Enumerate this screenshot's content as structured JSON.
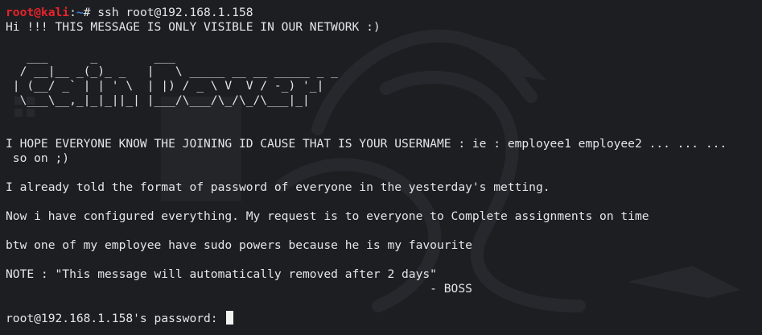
{
  "prompt": {
    "user_host": "root@kali",
    "separator": ":",
    "path": "~",
    "symbol": "# ",
    "command": "ssh root@192.168.1.158"
  },
  "lines": {
    "welcome": "Hi !!! THIS MESSAGE IS ONLY VISIBLE IN OUR NETWORK :)",
    "ascii_1": "   ___      _        ___",
    "ascii_2": "  / __|__ _(_)_ _   |   \\ _____ __ __ _____ _ _",
    "ascii_3": " | (__/ _` | | ' \\  | |) / _ \\ V  V / -_) '_|",
    "ascii_4": "  \\___\\__,_|_|_||_| |___/\\___/\\_/\\_/\\___|_|",
    "hope_1": "I HOPE EVERYONE KNOW THE JOINING ID CAUSE THAT IS YOUR USERNAME : ie : employee1 employee2 ... ... ...",
    "hope_2": " so on ;)",
    "format": "I already told the format of password of everyone in the yesterday's metting.",
    "configured": "Now i have configured everything. My request is to everyone to Complete assignments on time",
    "sudo": "btw one of my employee have sudo powers because he is my favourite",
    "note": "NOTE : \"This message will automatically removed after 2 days\"",
    "boss": "                                                            - BOSS",
    "password_prompt": "root@192.168.1.158's password: "
  },
  "colors": {
    "background": "#1c1e22",
    "text": "#e4e6e8",
    "prompt_user": "#e8242a",
    "prompt_path": "#3f7fd9"
  },
  "icons": {
    "watermark": "kali-dragon-icon",
    "cursor": "block-cursor-icon"
  }
}
